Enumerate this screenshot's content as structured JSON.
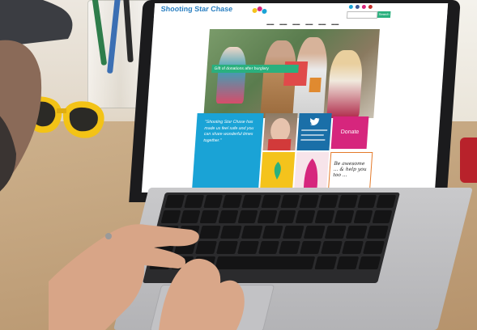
{
  "website": {
    "logo": "Shooting Star Chase",
    "tagline": "",
    "search_button": "Search",
    "hero_caption": "Gift of donations after burglary",
    "quote": "\"Shooting Star Chase has made us feel safe and you can share wonderful times together.\"",
    "donate_label": "Donate",
    "handwritten_note": "Be awesome ... & help you too ..."
  },
  "colors": {
    "accent_blue": "#1aa3d6",
    "accent_magenta": "#d6267d",
    "accent_green": "#2ab07e",
    "accent_yellow": "#f4c31c"
  }
}
